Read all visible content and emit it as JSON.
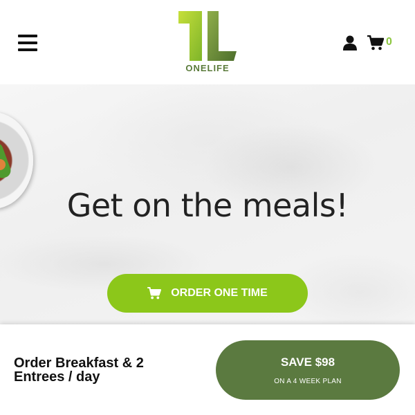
{
  "header": {
    "menu_icon": "hamburger-menu-icon",
    "logo_text": "ONELIFE",
    "user_icon": "user-icon",
    "cart_icon": "cart-icon",
    "cart_count": "0",
    "accent_color": "#8cc63f"
  },
  "hero": {
    "headline": "Get on the meals!",
    "order_button": {
      "label": "ORDER ONE TIME",
      "icon": "cart-icon",
      "color": "#8cc71a"
    }
  },
  "footer": {
    "plan_text": "Order Breakfast & 2 Entrees / day",
    "save_button": {
      "label": "SAVE $98",
      "sublabel": "ON A 4 WEEK PLAN",
      "color": "#5b7a40"
    }
  }
}
